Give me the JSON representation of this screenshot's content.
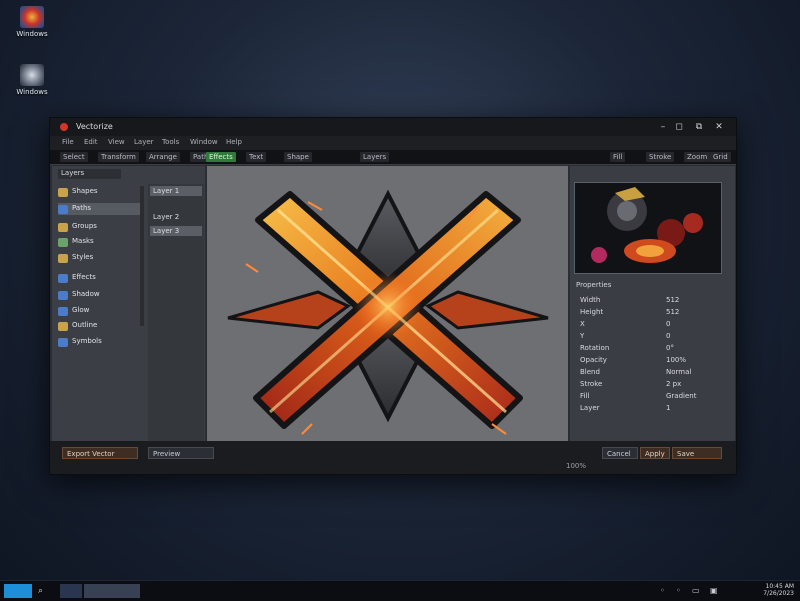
{
  "desktop": {
    "icons": [
      {
        "label": "Windows",
        "icon": "app-shortcut-icon"
      },
      {
        "label": "Windows",
        "icon": "settings-shortcut-icon"
      }
    ]
  },
  "window": {
    "title": "Vectorize",
    "controls": {
      "minimize": "–",
      "maximize": "◻",
      "restore": "⧉",
      "close": "✕"
    },
    "menu": [
      "File",
      "Edit",
      "View",
      "Layer",
      "Tools",
      "Window",
      "Help"
    ],
    "toolbar": {
      "left": [
        "Select",
        "Transform",
        "Arrange",
        "Path",
        "Effects",
        "Text",
        "Shape",
        "Layers"
      ],
      "right": [
        "Fill",
        "Stroke",
        "Zoom",
        "Grid"
      ],
      "active_index": 4
    },
    "sidebar": {
      "header": "Layers",
      "items": [
        {
          "label": "Shapes",
          "color": "#c9a34a"
        },
        {
          "label": "Paths",
          "color": "#4a7cc9"
        },
        {
          "label": "Groups",
          "color": "#c9a34a"
        },
        {
          "label": "Masks",
          "color": "#6aa36a"
        },
        {
          "label": "Styles",
          "color": "#c9a34a"
        },
        {
          "label": "Effects",
          "color": "#4a7cc9"
        },
        {
          "label": "Shadow",
          "color": "#4a7cc9"
        },
        {
          "label": "Glow",
          "color": "#4a7cc9"
        },
        {
          "label": "Outline",
          "color": "#c9a34a"
        },
        {
          "label": "Symbols",
          "color": "#4a7cc9"
        }
      ],
      "selected_index": 1,
      "subpanel": [
        "Layer 1",
        "Layer 2",
        "Layer 3"
      ]
    },
    "right_panel": {
      "title": "Properties",
      "rows": [
        {
          "key": "Width",
          "value": "512"
        },
        {
          "key": "Height",
          "value": "512"
        },
        {
          "key": "X",
          "value": "0"
        },
        {
          "key": "Y",
          "value": "0"
        },
        {
          "key": "Rotation",
          "value": "0°"
        },
        {
          "key": "Opacity",
          "value": "100%"
        },
        {
          "key": "Blend",
          "value": "Normal"
        },
        {
          "key": "Stroke",
          "value": "2 px"
        },
        {
          "key": "Fill",
          "value": "Gradient"
        },
        {
          "key": "Layer",
          "value": "1"
        }
      ]
    },
    "footer": {
      "left_buttons": [
        "Export Vector",
        "Preview"
      ],
      "right_buttons": [
        "Cancel",
        "Apply",
        "Save"
      ],
      "status": "100%"
    }
  },
  "taskbar": {
    "clock_time": "10:45 AM",
    "clock_date": "7/26/2023"
  },
  "colors": {
    "accent_orange": "#e0701c",
    "accent_red": "#b3261e",
    "active_tool_green": "#2f7a3a"
  }
}
